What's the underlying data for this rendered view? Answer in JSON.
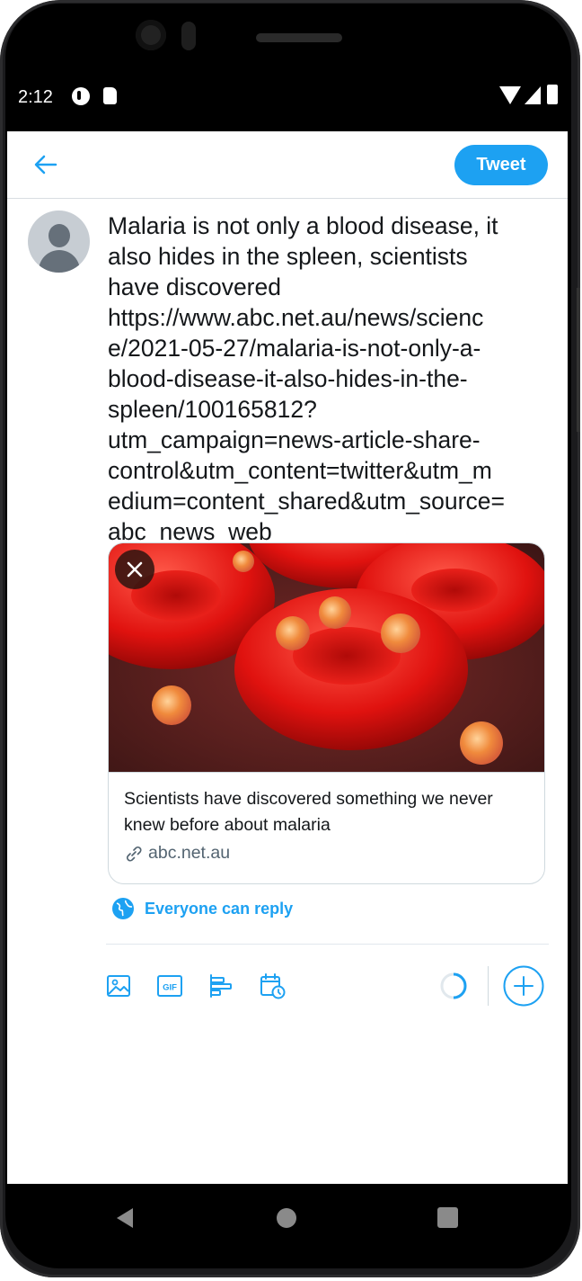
{
  "status_bar": {
    "time": "2:12"
  },
  "header": {
    "tweet_label": "Tweet"
  },
  "compose": {
    "text": "Malaria is not only a blood disease, it\nalso hides in the spleen, scientists\nhave discovered\nhttps://www.abc.net.au/news/scienc\ne/2021-05-27/malaria-is-not-only-a-\nblood-disease-it-also-hides-in-the-\nspleen/100165812?\nutm_campaign=news-article-share-\ncontrol&utm_content=twitter&utm_m\nedium=content_shared&utm_source=\nabc_news_web"
  },
  "link_card": {
    "title": "Scientists have discovered something we never knew before about malaria",
    "domain": "abc.net.au"
  },
  "reply_setting": {
    "label": "Everyone can reply"
  },
  "toolbar": {
    "icons": [
      "image-icon",
      "gif-icon",
      "poll-icon",
      "schedule-icon",
      "character-progress",
      "add-thread-icon"
    ]
  },
  "colors": {
    "accent": "#1da1f2",
    "text": "#14171a",
    "secondary": "#536471",
    "border": "#cfd9de"
  }
}
